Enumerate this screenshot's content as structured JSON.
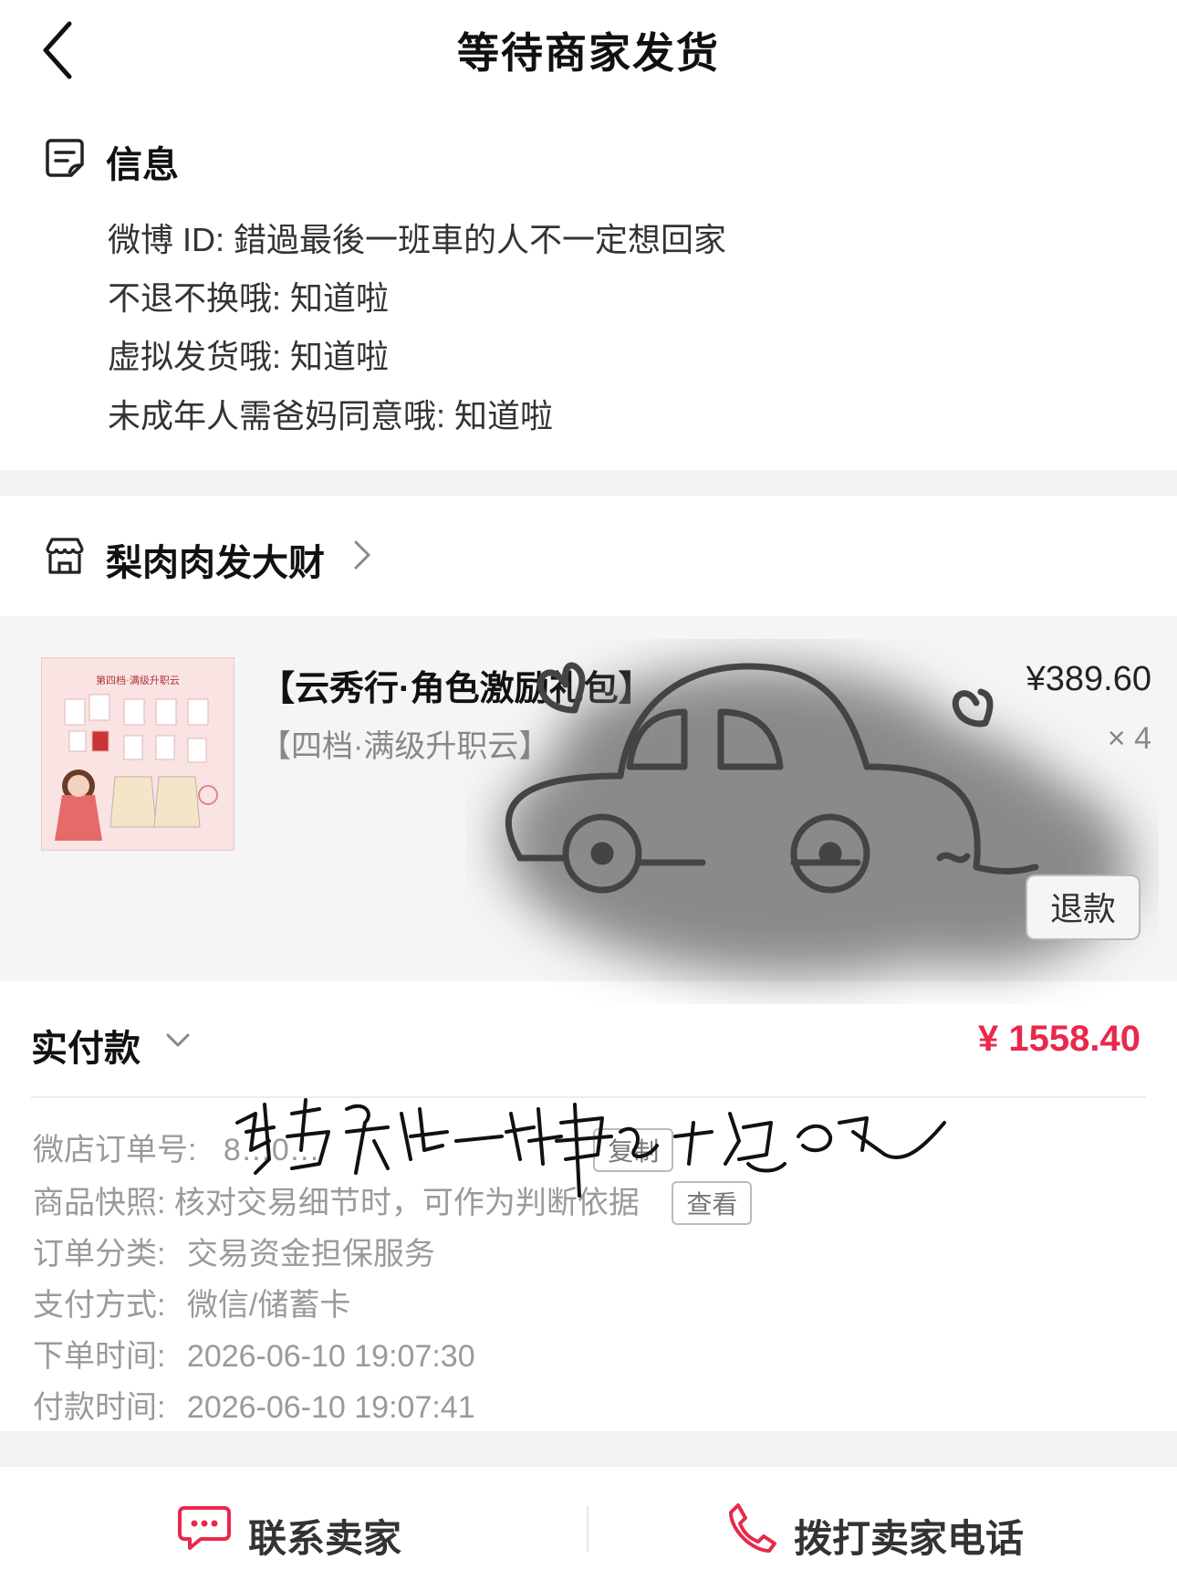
{
  "header": {
    "title": "等待商家发货"
  },
  "info": {
    "heading": "信息",
    "lines": [
      "微博 ID: 錯過最後一班車的人不一定想回家",
      "不退不换哦: 知道啦",
      "虚拟发货哦: 知道啦",
      "未成年人需爸妈同意哦: 知道啦"
    ]
  },
  "shop": {
    "name": "梨肉肉发大财"
  },
  "product": {
    "title": "【云秀行·角色激励礼包】",
    "sku": "【四档·满级升职云】",
    "price": "¥389.60",
    "quantity": "× 4",
    "refund_label": "退款",
    "thumb_text": "第四档·满级升职云"
  },
  "payment": {
    "label": "实付款",
    "amount": "¥ 1558.40"
  },
  "details": {
    "order_no_label": "微店订单号:",
    "order_no_value": "8…0…",
    "copy_label": "复制",
    "snapshot_label": "商品快照:",
    "snapshot_value": "核对交易细节时，可作为判断依据",
    "view_label": "查看",
    "category_label": "订单分类:",
    "category_value": "交易资金担保服务",
    "pay_method_label": "支付方式:",
    "pay_method_value": "微信/储蓄卡",
    "order_time_label": "下单时间:",
    "order_time_value": "2026-06-10 19:07:30",
    "pay_time_label": "付款时间:",
    "pay_time_value": "2026-06-10 19:07:41"
  },
  "bottom_bar": {
    "contact_label": "联系卖家",
    "call_label": "拨打卖家电话"
  },
  "colors": {
    "accent_red": "#e8294b",
    "icon_red": "#e8294b"
  },
  "icons": [
    "back-chevron-icon",
    "info-doc-icon",
    "shop-icon",
    "chevron-right-icon",
    "chevron-down-icon",
    "chat-icon",
    "phone-icon"
  ]
}
